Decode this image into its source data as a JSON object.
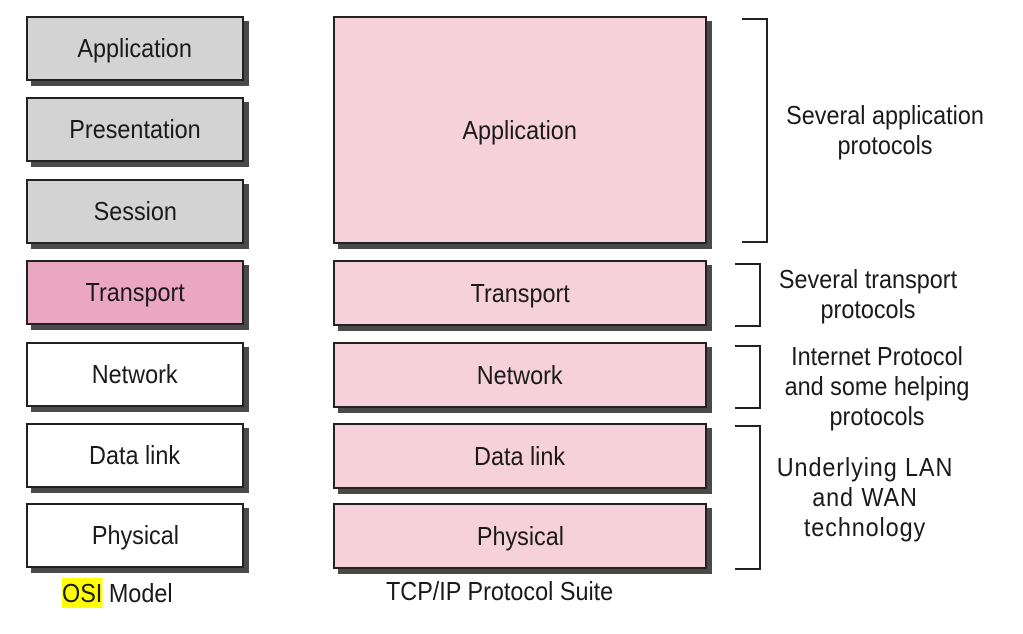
{
  "osi": {
    "layers": [
      "Application",
      "Presentation",
      "Session",
      "Transport",
      "Network",
      "Data link",
      "Physical"
    ],
    "caption_highlight": "OSI",
    "caption_rest": " Model"
  },
  "tcpip": {
    "layers": [
      "Application",
      "Transport",
      "Network",
      "Data link",
      "Physical"
    ],
    "caption": "TCP/IP Protocol Suite"
  },
  "notes": [
    "Several application protocols",
    "Several transport protocols",
    "Internet Protocol and some helping protocols",
    "Underlying LAN and WAN technology"
  ],
  "colors": {
    "upper": "#d3d3d3",
    "transport_highlight": "#eba7c2",
    "lower": "#ffffff",
    "tcpip": "#f6d1dc",
    "caption_highlight": "#ffff00"
  }
}
